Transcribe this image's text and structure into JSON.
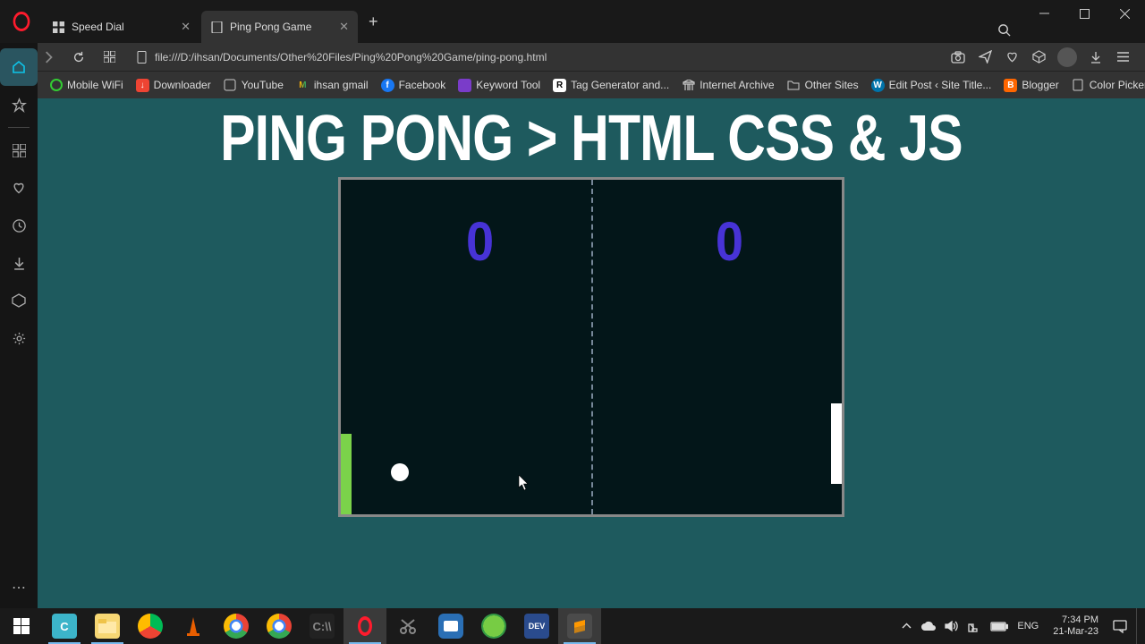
{
  "browser": {
    "tabs": [
      {
        "label": "Speed Dial",
        "active": false
      },
      {
        "label": "Ping Pong Game",
        "active": true
      }
    ],
    "url": "file:///D:/ihsan/Documents/Other%20Files/Ping%20Pong%20Game/ping-pong.html"
  },
  "bookmarks": [
    {
      "label": "Mobile WiFi"
    },
    {
      "label": "Downloader"
    },
    {
      "label": "YouTube"
    },
    {
      "label": "ihsan gmail"
    },
    {
      "label": "Facebook"
    },
    {
      "label": "Keyword Tool"
    },
    {
      "label": "Tag Generator and..."
    },
    {
      "label": "Internet Archive"
    },
    {
      "label": "Other Sites"
    },
    {
      "label": "Edit Post ‹ Site Title..."
    },
    {
      "label": "Blogger"
    },
    {
      "label": "Color Picker"
    }
  ],
  "page": {
    "title": "PING PONG > HTML CSS & JS",
    "score_left": "0",
    "score_right": "0"
  },
  "taskbar": {
    "lang": "ENG",
    "time": "7:34 PM",
    "date": "21-Mar-23"
  }
}
